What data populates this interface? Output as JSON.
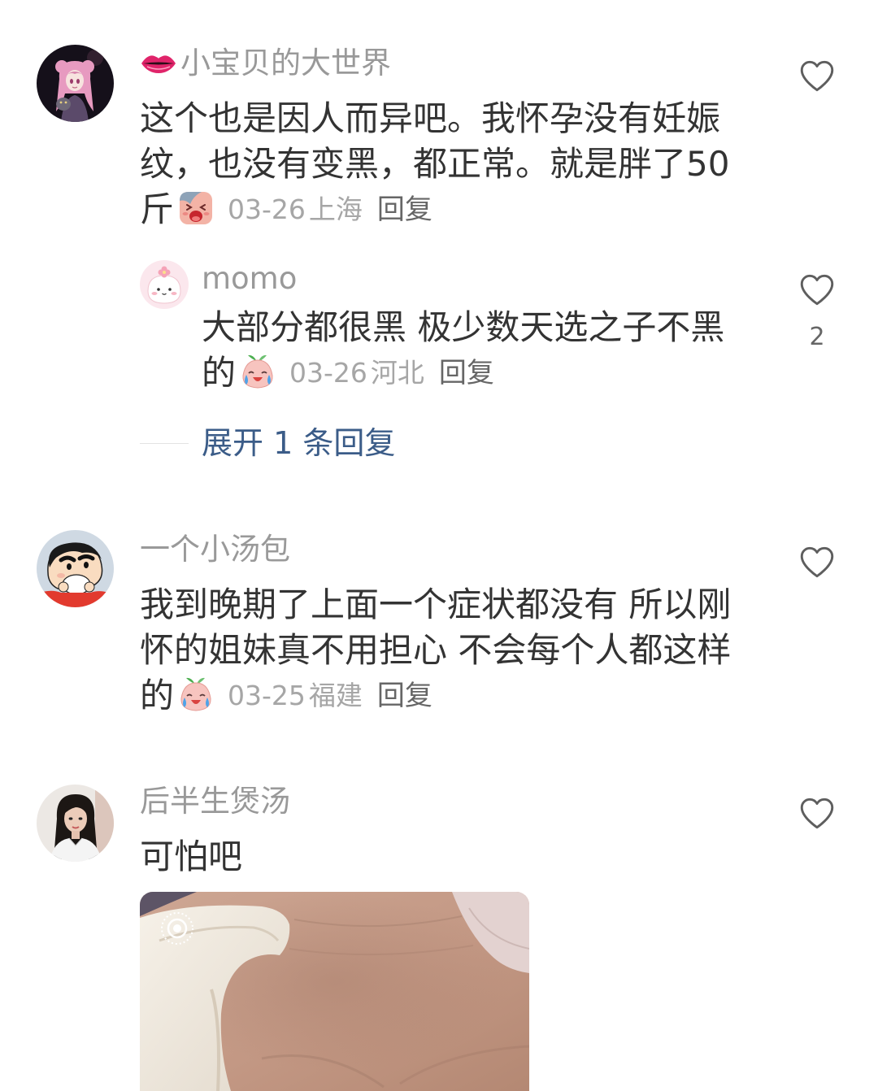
{
  "colors": {
    "background": "#ffffff",
    "text": "#333333",
    "username": "#999999",
    "meta": "#a6a6a6",
    "reply": "#666666",
    "link": "#3b5c88",
    "icon": "#5e5e5e"
  },
  "icons": {
    "like": "heart-outline-icon",
    "username_emoji": "lips-emoji-icon",
    "photo_badge": "live-photo-icon"
  },
  "comments": [
    {
      "username": "小宝贝的大世界",
      "text": "这个也是因人而异吧。我怀孕没有妊娠纹，也没有变黑，都正常。就是胖了50斤",
      "sticker": "screaming-face-sticker",
      "date": "03-26",
      "location": "上海",
      "reply_label": "回复",
      "replies": [
        {
          "username": "momo",
          "text": "大部分都很黑 极少数天选之子不黑的",
          "sticker": "crying-peach-sticker",
          "date": "03-26",
          "location": "河北",
          "reply_label": "回复",
          "like_count": "2"
        }
      ],
      "expand_replies_label": "展开 1 条回复"
    },
    {
      "username": "一个小汤包",
      "text": "我到晚期了上面一个症状都没有 所以刚怀的姐妹真不用担心 不会每个人都这样的",
      "sticker": "crying-peach-sticker",
      "date": "03-25",
      "location": "福建",
      "reply_label": "回复"
    },
    {
      "username": "后半生煲汤",
      "text": "可怕吧"
    }
  ]
}
